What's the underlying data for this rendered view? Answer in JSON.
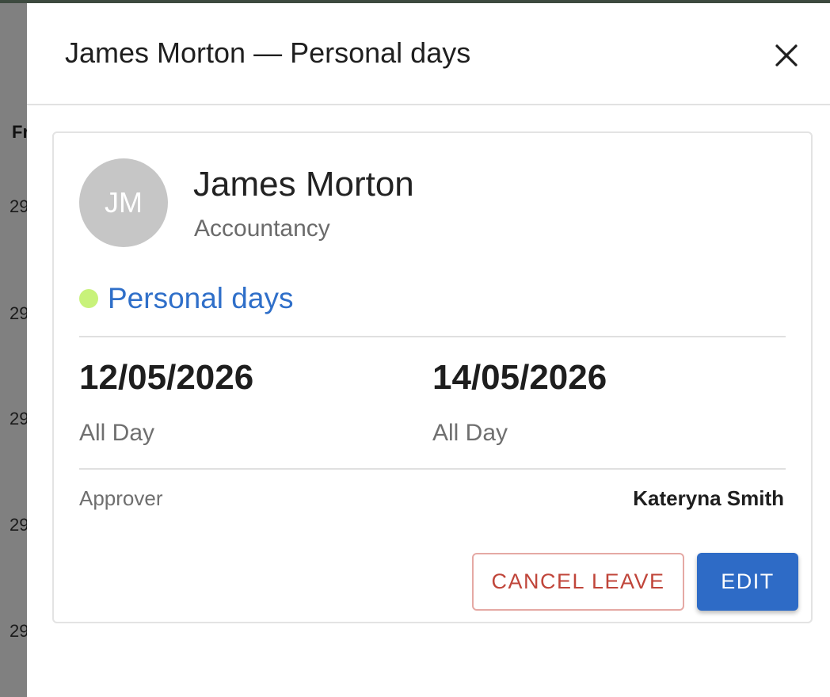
{
  "background": {
    "column_header_partial": "Fr",
    "date_cells_partial": [
      "29",
      "29",
      "29",
      "29",
      "29"
    ]
  },
  "drawer": {
    "title": "James Morton — Personal days",
    "close_icon": "close-icon"
  },
  "leave_card": {
    "employee": {
      "initials": "JM",
      "name": "James Morton",
      "department": "Accountancy"
    },
    "leave_type": {
      "label": "Personal days",
      "dot_color": "#c8f27a",
      "label_color": "#2f6fc9"
    },
    "start": {
      "date": "12/05/2026",
      "period": "All Day"
    },
    "end": {
      "date": "14/05/2026",
      "period": "All Day"
    },
    "approver": {
      "label": "Approver",
      "name": "Kateryna Smith"
    },
    "actions": {
      "cancel_label": "CANCEL LEAVE",
      "edit_label": "EDIT"
    }
  },
  "colors": {
    "primary": "#2e6bc6",
    "danger": "#c0453a"
  }
}
